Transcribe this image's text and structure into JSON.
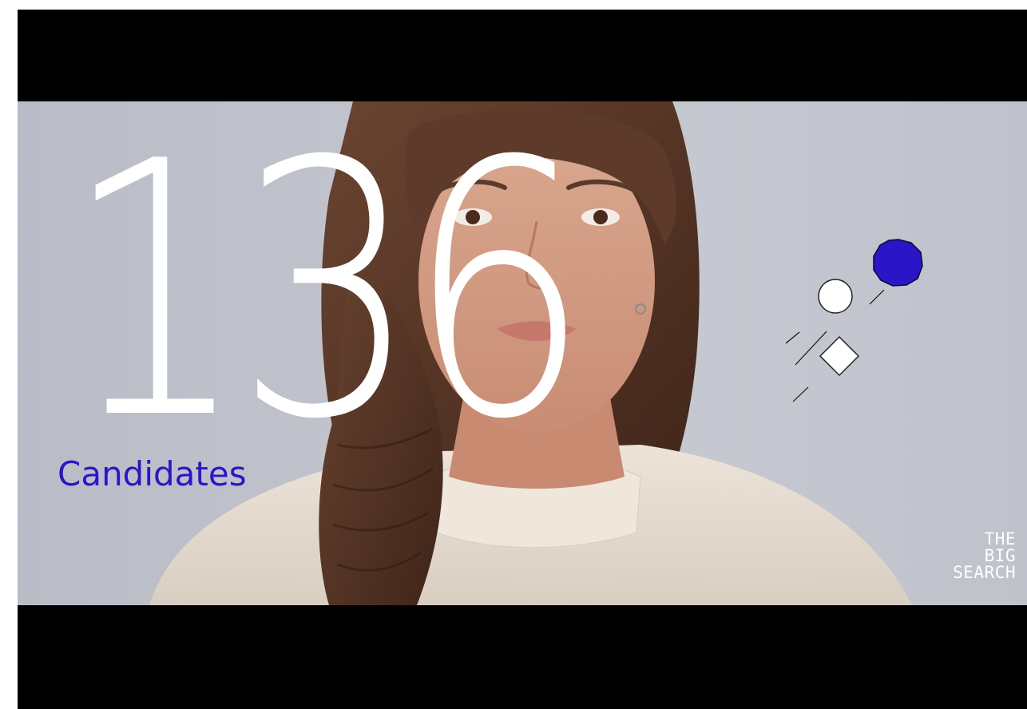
{
  "hero": {
    "number": "136",
    "label": "Candidates"
  },
  "brand": {
    "line1": "THE",
    "line2": "BIG",
    "line3": "SEARCH"
  },
  "colors": {
    "accent": "#2a16c8",
    "letterbox": "#000000",
    "number": "#ffffff",
    "background": "#c3c5ce"
  },
  "icons": [
    "filled-octagon-icon",
    "white-circle-icon",
    "white-diamond-icon",
    "dash-lines-icon"
  ]
}
